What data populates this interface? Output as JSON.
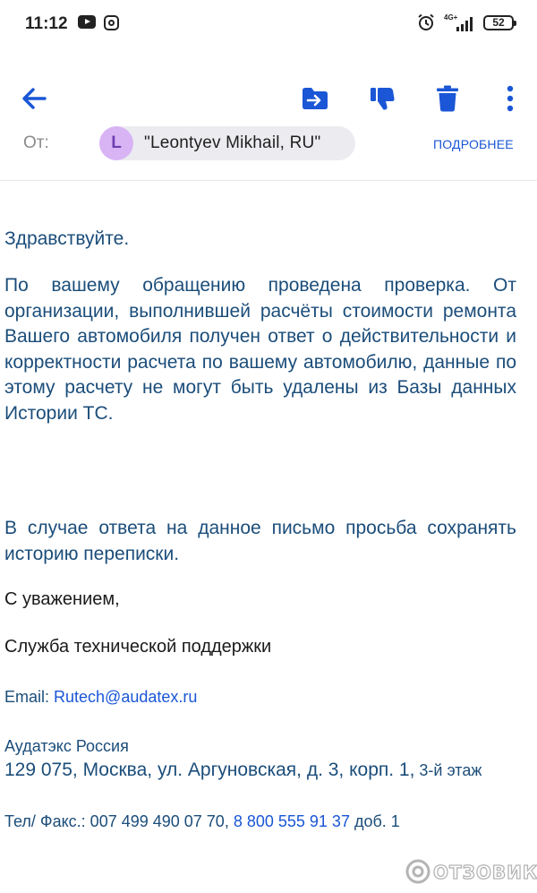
{
  "status_bar": {
    "time": "11:12",
    "network": "4G+",
    "battery": "52"
  },
  "toolbar": {
    "back_icon": "arrow-left-icon",
    "move_icon": "move-to-folder-icon",
    "spam_icon": "thumbs-down-icon",
    "delete_icon": "trash-icon",
    "more_icon": "more-vertical-icon",
    "accent": "#1a56d6"
  },
  "header": {
    "from_label": "От:",
    "avatar_letter": "L",
    "sender_name": "\"Leontyev Mikhail, RU\"",
    "details_link": "ПОДРОБНЕЕ"
  },
  "body": {
    "greeting": "Здравствуйте.",
    "paragraph1": "По вашему обращению проведена проверка. От организации, выполнившей расчёты стоимости ремонта Вашего автомобиля получен ответ о действительности и корректности расчета по вашему автомобилю, данные по этому расчету не могут быть удалены из Базы данных Истории ТС.",
    "paragraph2": "В случае ответа на данное письмо просьба сохранять историю переписки.",
    "regards": "С уважением,",
    "signature": "Служба технической поддержки",
    "email_label": "Email: ",
    "email": "Rutech@audatex.ru",
    "company": "Аудатэкс Россия",
    "address_main": "129 075, Москва, ул. Аргуновская, д. 3, корп. 1,",
    "address_floor": " 3-й этаж",
    "phone_label": "Тел/ Факс.: 007 499 490 07 70, ",
    "phone_link": "8 800 555 91 37",
    "phone_ext": " доб. 1"
  },
  "watermark": {
    "text": "ОТЗОВИК"
  }
}
